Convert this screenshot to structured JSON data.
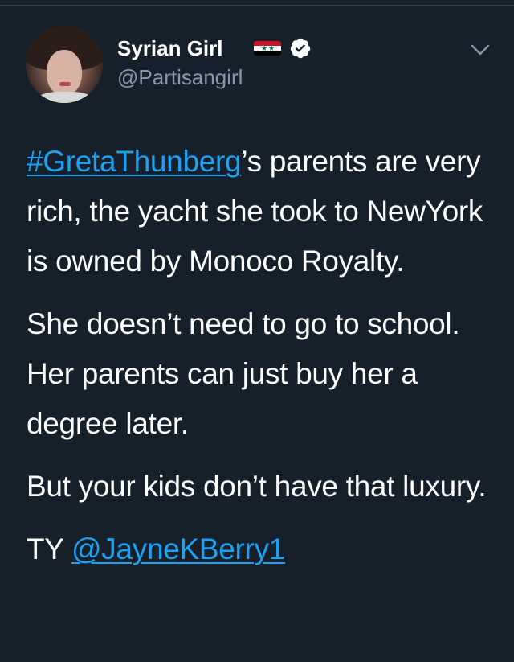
{
  "author": {
    "display_name": "Syrian Girl",
    "handle": "@Partisangirl",
    "verified": true,
    "flag": "syria-flag"
  },
  "tweet": {
    "hashtag": "#GretaThunberg",
    "p1_rest": "’s parents are very rich, the yacht she took to NewYork is owned by Monoco Royalty.",
    "p2": "She doesn’t need to go to school. Her parents can just buy her a degree later.",
    "p3": "But your kids don’t have that luxury.",
    "p4_prefix": "TY ",
    "mention": "@JayneKBerry1"
  },
  "icons": {
    "verified": "verified-badge-icon",
    "menu": "chevron-down-icon"
  },
  "colors": {
    "background": "#15202b",
    "link": "#1da1f2",
    "secondary_text": "#8899a6"
  }
}
